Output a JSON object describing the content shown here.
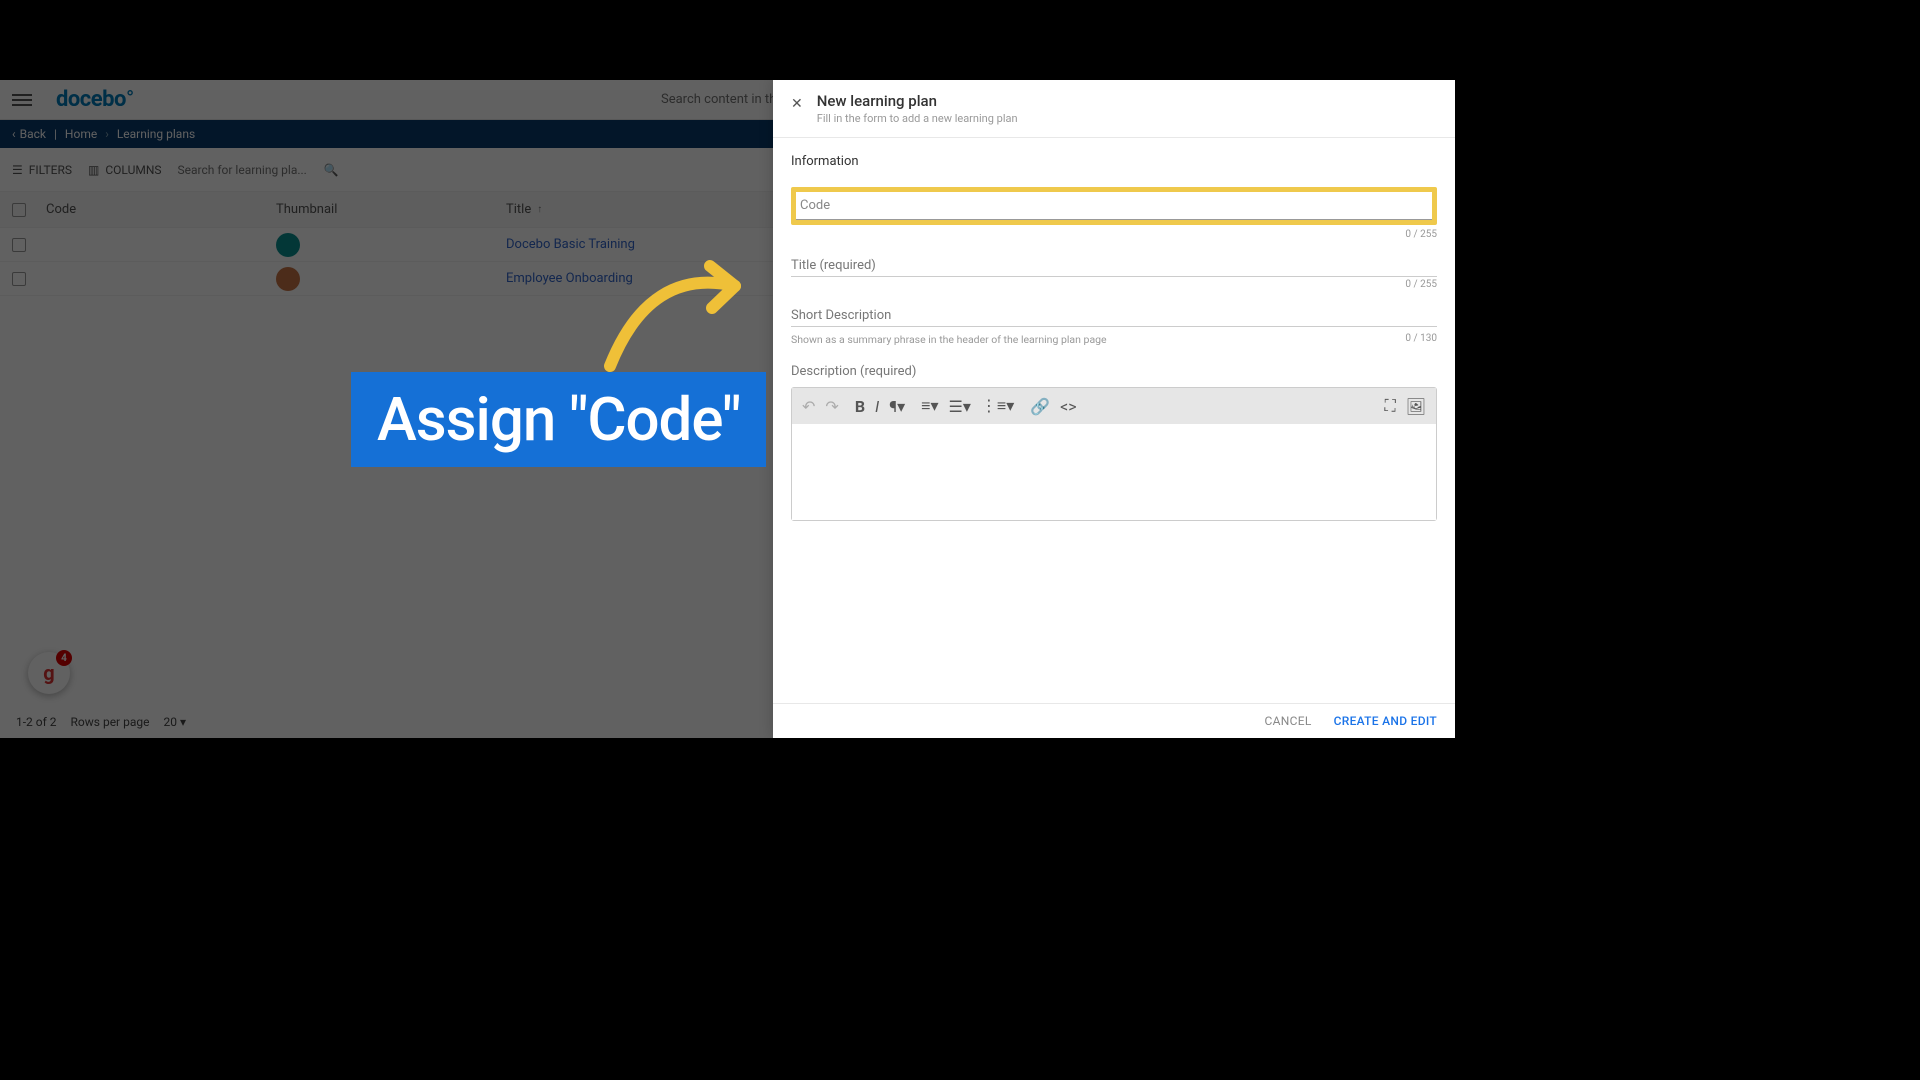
{
  "header": {
    "logo": "docebo",
    "search_placeholder": "Search content in the platform"
  },
  "breadcrumb": {
    "back": "Back",
    "items": [
      "Home",
      "Learning plans"
    ]
  },
  "toolbar": {
    "filters": "FILTERS",
    "columns": "COLUMNS",
    "search_placeholder": "Search for learning pla..."
  },
  "table": {
    "columns": {
      "code": "Code",
      "thumbnail": "Thumbnail",
      "title": "Title"
    },
    "rows": [
      {
        "code": "",
        "thumb_color": "#0a9191",
        "title": "Docebo Basic Training"
      },
      {
        "code": "",
        "thumb_color": "#c87545",
        "title": "Employee Onboarding"
      }
    ]
  },
  "footer": {
    "range": "1-2 of 2",
    "rows_label": "Rows per page",
    "rows_value": "20"
  },
  "badge": {
    "letter": "g",
    "count": "4"
  },
  "callout": {
    "text": "Assign \"Code\""
  },
  "panel": {
    "title": "New learning plan",
    "subtitle": "Fill in the form to add a new learning plan",
    "section": "Information",
    "code_placeholder": "Code",
    "code_counter": "0 / 255",
    "title_label": "Title  (required)",
    "title_counter": "0 / 255",
    "short_label": "Short Description",
    "short_hint": "Shown as a summary phrase in the header of the learning plan page",
    "short_counter": "0 / 130",
    "desc_label": "Description (required)",
    "cancel": "CANCEL",
    "create": "CREATE AND EDIT"
  }
}
